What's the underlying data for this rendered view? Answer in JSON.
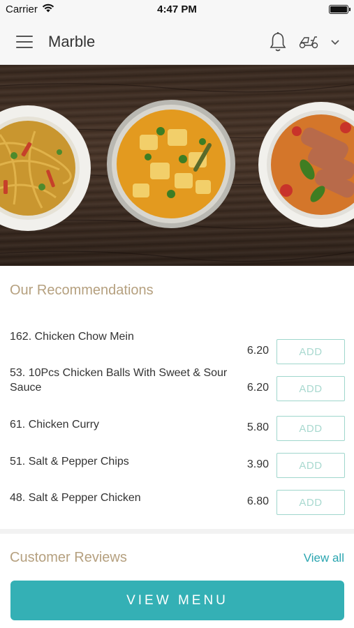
{
  "status_bar": {
    "carrier": "Carrier",
    "time": "4:47 PM",
    "battery_level": 1.0
  },
  "header": {
    "title": "Marble",
    "icons": [
      "menu-icon",
      "bell-icon",
      "scooter-icon",
      "chevron-down-icon"
    ]
  },
  "hero": {
    "image": "food-banner",
    "dishes": [
      "noodles",
      "curry",
      "duck-curry"
    ]
  },
  "recommendations": {
    "title": "Our Recommendations",
    "items": [
      {
        "name": "162. Chicken Chow Mein",
        "price": "6.20",
        "add_label": "ADD"
      },
      {
        "name": "53. 10Pcs Chicken Balls With Sweet & Sour Sauce",
        "price": "6.20",
        "add_label": "ADD"
      },
      {
        "name": "61. Chicken Curry",
        "price": "5.80",
        "add_label": "ADD"
      },
      {
        "name": "51. Salt & Pepper Chips",
        "price": "3.90",
        "add_label": "ADD"
      },
      {
        "name": "48. Salt & Pepper Chicken",
        "price": "6.80",
        "add_label": "ADD"
      }
    ]
  },
  "reviews": {
    "title": "Customer Reviews",
    "view_all_label": "View all"
  },
  "footer": {
    "view_menu_label": "VIEW MENU"
  },
  "colors": {
    "accent": "#34b0b5",
    "section_title": "#b5a07f",
    "link": "#2aa5b0",
    "add_border": "#9fd6cc"
  }
}
